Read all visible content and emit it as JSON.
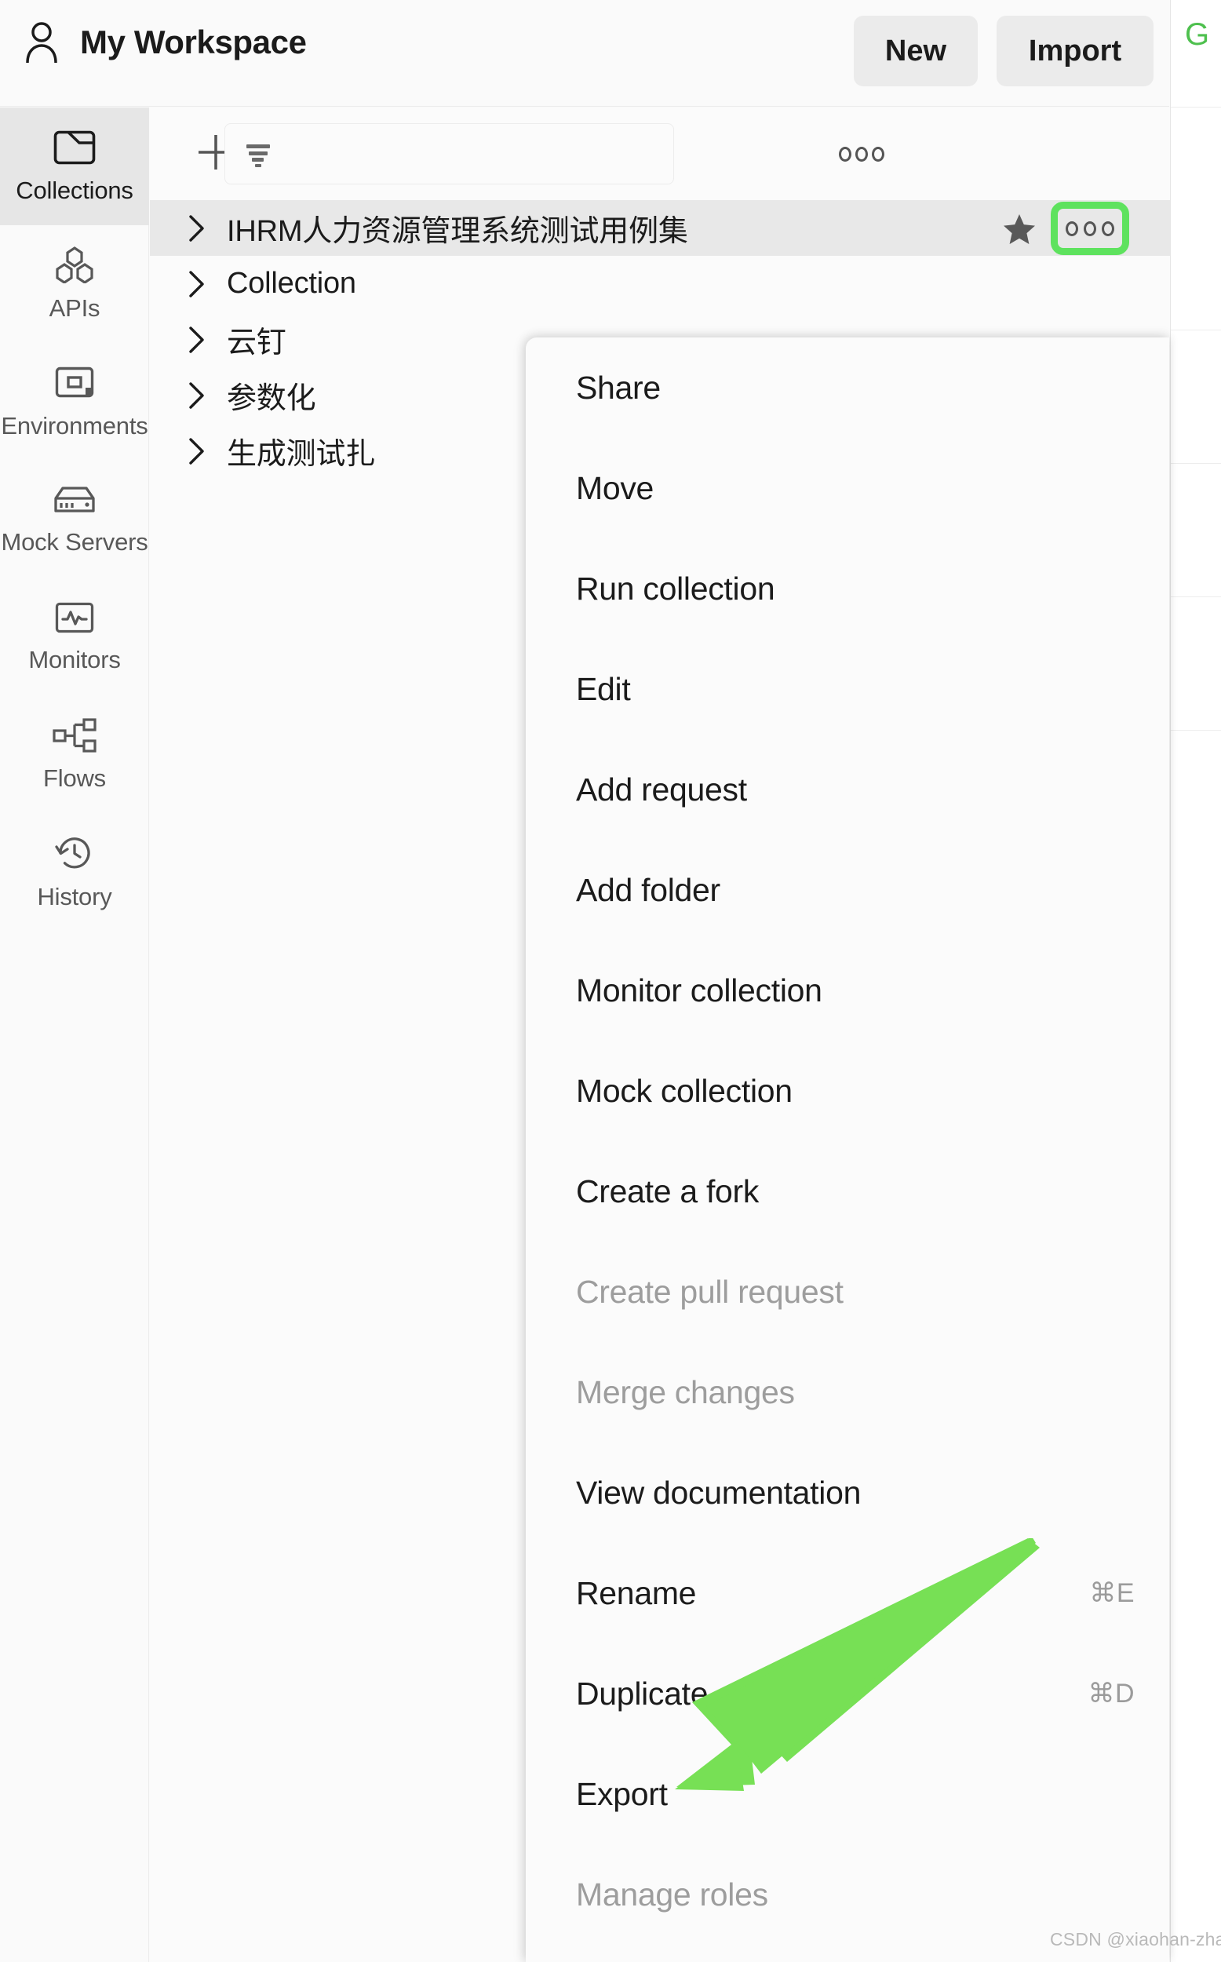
{
  "colors": {
    "accent_green": "#5ee25e",
    "arrow_green": "#77e055",
    "rail_active_bg": "#e6e6e6",
    "row_selected_bg": "#e8e8e8",
    "page_bg": "#fafafa",
    "disabled_text": "#9d9d9d"
  },
  "topbar": {
    "workspace_title": "My Workspace",
    "workspace_icon": "person-icon",
    "new_label": "New",
    "import_label": "Import"
  },
  "right_panel": {
    "badge": "G"
  },
  "rail": {
    "items": [
      {
        "label": "Collections",
        "icon": "collections-icon",
        "active": true
      },
      {
        "label": "APIs",
        "icon": "apis-icon",
        "active": false
      },
      {
        "label": "Environments",
        "icon": "environments-icon",
        "active": false
      },
      {
        "label": "Mock Servers",
        "icon": "mock-servers-icon",
        "active": false
      },
      {
        "label": "Monitors",
        "icon": "monitors-icon",
        "active": false
      },
      {
        "label": "Flows",
        "icon": "flows-icon",
        "active": false
      },
      {
        "label": "History",
        "icon": "history-icon",
        "active": false
      }
    ]
  },
  "list_toolbar": {
    "add_icon": "plus-icon",
    "filter_icon": "filter-icon",
    "filter_value": "",
    "filter_placeholder": "",
    "more_icon": "ellipsis-icon"
  },
  "collections": [
    {
      "name": "IHRM人力资源管理系统测试用例集",
      "selected": true,
      "starred": true
    },
    {
      "name": "Collection",
      "selected": false,
      "starred": false
    },
    {
      "name": "云钉",
      "selected": false,
      "starred": false
    },
    {
      "name": "参数化",
      "selected": false,
      "starred": false
    },
    {
      "name": "生成测试扎",
      "selected": false,
      "starred": false
    }
  ],
  "row_actions": {
    "star_icon": "star-filled-icon",
    "more_icon": "ellipsis-icon"
  },
  "context_menu": {
    "items": [
      {
        "label": "Share",
        "shortcut": "",
        "disabled": false
      },
      {
        "label": "Move",
        "shortcut": "",
        "disabled": false
      },
      {
        "label": "Run collection",
        "shortcut": "",
        "disabled": false
      },
      {
        "label": "Edit",
        "shortcut": "",
        "disabled": false
      },
      {
        "label": "Add request",
        "shortcut": "",
        "disabled": false
      },
      {
        "label": "Add folder",
        "shortcut": "",
        "disabled": false
      },
      {
        "label": "Monitor collection",
        "shortcut": "",
        "disabled": false
      },
      {
        "label": "Mock collection",
        "shortcut": "",
        "disabled": false
      },
      {
        "label": "Create a fork",
        "shortcut": "",
        "disabled": false
      },
      {
        "label": "Create pull request",
        "shortcut": "",
        "disabled": true
      },
      {
        "label": "Merge changes",
        "shortcut": "",
        "disabled": true
      },
      {
        "label": "View documentation",
        "shortcut": "",
        "disabled": false
      },
      {
        "label": "Rename",
        "shortcut": "⌘E",
        "disabled": false
      },
      {
        "label": "Duplicate",
        "shortcut": "⌘D",
        "disabled": false
      },
      {
        "label": "Export",
        "shortcut": "",
        "disabled": false
      },
      {
        "label": "Manage roles",
        "shortcut": "",
        "disabled": true
      }
    ]
  },
  "annotation": {
    "arrow_target": "Export",
    "highlight_target": "collection-row-more-button"
  },
  "watermark": {
    "text": "CSDN @xiaohan-zhang"
  }
}
